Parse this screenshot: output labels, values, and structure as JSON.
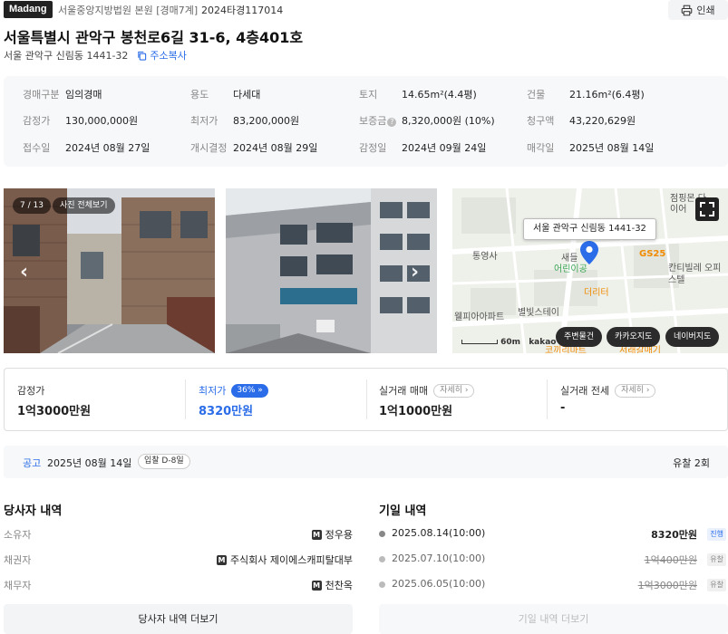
{
  "header": {
    "logo": "Madang",
    "court": "서울중앙지방법원 본원 [경매7계]",
    "case_no": "2024타경117014",
    "print_label": "인쇄"
  },
  "property": {
    "title": "서울특별시 관악구 봉천로6길 31-6, 4층401호",
    "jibun": "서울 관악구 신림동 1441-32",
    "copy_label": "주소복사"
  },
  "info": [
    {
      "label": "경매구분",
      "value": "임의경매"
    },
    {
      "label": "용도",
      "value": "다세대"
    },
    {
      "label": "토지",
      "value": "14.65m²(4.4평)"
    },
    {
      "label": "건물",
      "value": "21.16m²(6.4평)"
    },
    {
      "label": "감정가",
      "value": "130,000,000원"
    },
    {
      "label": "최저가",
      "value": "83,200,000원"
    },
    {
      "label": "보증금",
      "value": "8,320,000원 (10%)",
      "help": "?"
    },
    {
      "label": "청구액",
      "value": "43,220,629원"
    },
    {
      "label": "접수일",
      "value": "2024년 08월 27일"
    },
    {
      "label": "개시결정",
      "value": "2024년 08월 29일"
    },
    {
      "label": "감정일",
      "value": "2024년 09월 24일"
    },
    {
      "label": "매각일",
      "value": "2025년 08월 14일"
    }
  ],
  "photos": {
    "counter": "7 / 13",
    "view_all": "사진 전체보기",
    "prev": "‹",
    "next": "›"
  },
  "map": {
    "tooltip": "서울 관악구 신림동 1441-32",
    "labels": [
      "통영사",
      "새들",
      "어린이공",
      "GS25",
      "칸티빌레 오피스텔",
      "더리터",
      "웰피아아파트",
      "별빛스테이",
      "점핑몬 다이어",
      "서래갈매기",
      "코끼리마트"
    ],
    "scale": "60m",
    "brand": "kakao",
    "buttons": [
      "주변물건",
      "카카오지도",
      "네이버지도"
    ]
  },
  "prices": {
    "appraisal": {
      "label": "감정가",
      "value": "1억3000만원"
    },
    "minimum": {
      "label": "최저가",
      "value": "8320만원",
      "badge": "36%"
    },
    "trade": {
      "label": "실거래 매매",
      "value": "1억1000만원",
      "detail": "자세히"
    },
    "jeonse": {
      "label": "실거래 전세",
      "value": "-",
      "detail": "자세히"
    }
  },
  "notice": {
    "label": "공고",
    "date": "2025년 08월 14일",
    "dday": "입찰 D-8일",
    "fail_count": "유찰 2회"
  },
  "parties": {
    "title": "당사자 내역",
    "rows": [
      {
        "label": "소유자",
        "value": "정우용"
      },
      {
        "label": "채권자",
        "value": "주식회사 제이에스캐피탈대부"
      },
      {
        "label": "채무자",
        "value": "천찬옥"
      }
    ],
    "badge": "M",
    "more": "당사자 내역 더보기"
  },
  "history": {
    "title": "기일 내역",
    "rows": [
      {
        "date": "2025.08.14(10:00)",
        "price": "8320만원",
        "status": "진행"
      },
      {
        "date": "2025.07.10(10:00)",
        "price": "1억400만원",
        "status": "유찰"
      },
      {
        "date": "2025.06.05(10:00)",
        "price": "1억3000만원",
        "status": "유찰"
      }
    ],
    "more": "기일 내역 더보기"
  },
  "colors": {
    "accent": "#2b6de8",
    "map_pin": "#2b6de8",
    "map_green": "#3aa655",
    "map_orange": "#f08a00"
  }
}
